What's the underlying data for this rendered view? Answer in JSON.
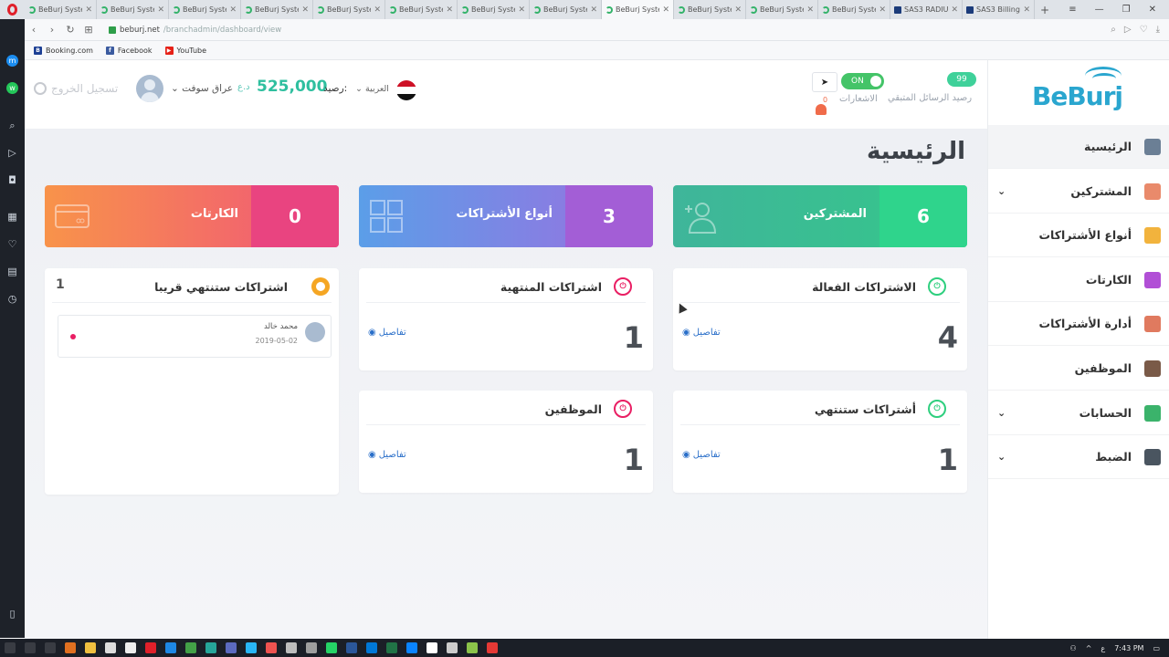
{
  "browser": {
    "tabs": [
      {
        "label": "BeBurj Syste",
        "active": false
      },
      {
        "label": "BeBurj Syste",
        "active": false
      },
      {
        "label": "BeBurj Syste",
        "active": false
      },
      {
        "label": "BeBurj Syste",
        "active": false
      },
      {
        "label": "BeBurj Syste",
        "active": false
      },
      {
        "label": "BeBurj Syste",
        "active": false
      },
      {
        "label": "BeBurj Syste",
        "active": false
      },
      {
        "label": "BeBurj Syste",
        "active": false
      },
      {
        "label": "BeBurj Syste",
        "active": true
      },
      {
        "label": "BeBurj Syste",
        "active": false
      },
      {
        "label": "BeBurj Syste",
        "active": false
      },
      {
        "label": "BeBurj Syste",
        "active": false
      },
      {
        "label": "SAS3 RADIU",
        "active": false
      },
      {
        "label": "SAS3 Billing",
        "active": false
      }
    ],
    "url_host": "beburj.net",
    "url_path": "/branchadmin/dashboard/view",
    "bookmarks": [
      "Booking.com",
      "Facebook",
      "YouTube"
    ]
  },
  "topbar": {
    "logout_label": "تسجيل الخروج",
    "username": "عراق سوفت",
    "currency": "د.ع",
    "balance_amount": "525,000",
    "balance_label": "رصيد:",
    "language": "العربية",
    "notifications_count": "0",
    "notifications_label": "الاشعارات",
    "toggle_label": "ON",
    "sms_count": "99",
    "sms_label": "رصيد الرسائل المتبقي"
  },
  "page": {
    "title": "الرئيسية"
  },
  "stats": [
    {
      "label": "المشتركين",
      "value": "6"
    },
    {
      "label": "أنواع الأشتراكات",
      "value": "3"
    },
    {
      "label": "الكارتات",
      "value": "0"
    }
  ],
  "cards": {
    "active_subs": {
      "title": "الاشتراكات الفعالة",
      "value": "4",
      "details": "تفاصيل"
    },
    "expired_subs": {
      "title": "اشتراكات المنتهية",
      "value": "1",
      "details": "تفاصيل"
    },
    "expiring_subs": {
      "title": "أشتراكات ستنتهي",
      "value": "1",
      "details": "تفاصيل"
    },
    "employees": {
      "title": "الموظفين",
      "value": "1",
      "details": "تفاصيل"
    }
  },
  "soon": {
    "title": "اشتراكات ستنتهي قريبا",
    "count": "1",
    "items": [
      {
        "name": "محمد خالد",
        "date": "2019-05-02"
      }
    ]
  },
  "nav": {
    "logo": "BeBurj",
    "items": [
      {
        "label": "الرئيسية",
        "icon": "dashboard-icon",
        "color": "#6b7f95",
        "has_sub": false,
        "active": true
      },
      {
        "label": "المشتركين",
        "icon": "user-icon",
        "color": "#e98a6b",
        "has_sub": true,
        "active": false
      },
      {
        "label": "أنواع الأشتراكات",
        "icon": "puzzle-icon",
        "color": "#f2b33d",
        "has_sub": false,
        "active": false
      },
      {
        "label": "الكارتات",
        "icon": "card-icon",
        "color": "#b14fd6",
        "has_sub": false,
        "active": false
      },
      {
        "label": "أدارة الأشتراكات",
        "icon": "calendar-icon",
        "color": "#e07a5f",
        "has_sub": false,
        "active": false
      },
      {
        "label": "الموظفين",
        "icon": "briefcase-icon",
        "color": "#7a5a48",
        "has_sub": false,
        "active": false
      },
      {
        "label": "الحسابات",
        "icon": "chart-icon",
        "color": "#3bb36b",
        "has_sub": true,
        "active": false
      },
      {
        "label": "الضبط",
        "icon": "gear-icon",
        "color": "#4a5560",
        "has_sub": true,
        "active": false
      }
    ]
  },
  "taskbar": {
    "time": "7:43 PM",
    "lang": "ع"
  }
}
